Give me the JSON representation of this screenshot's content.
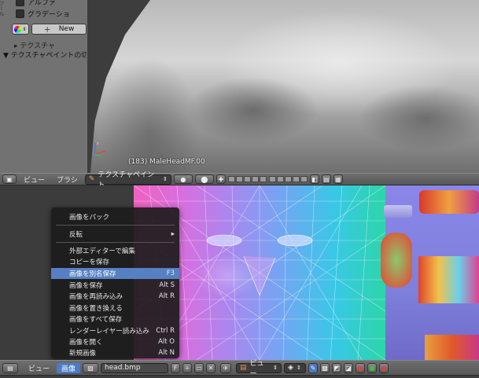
{
  "tool_panel": {
    "handle_label": "ツール",
    "alpha_label": "アルファ",
    "gradient_label": "グラデーショ",
    "new_label": "New",
    "texture_section": "テクスチャ",
    "texture_paint_section": "▼ テクスチャペイントの切"
  },
  "viewport": {
    "info": "(183) MaleHeadMF.00"
  },
  "header_top": {
    "view": "ビュー",
    "brush": "ブラシ",
    "mode": "テクスチャペイント"
  },
  "header_bottom": {
    "view": "ビュー",
    "image": "画像",
    "image_name": "head.bmp",
    "fake_user": "F",
    "view_mode": "ビュー"
  },
  "image_menu": {
    "items": [
      {
        "label": "画像をパック",
        "shortcut": ""
      },
      {
        "label": "反転",
        "shortcut": "▸"
      },
      {
        "label": "外部エディターで編集",
        "shortcut": ""
      },
      {
        "label": "コピーを保存",
        "shortcut": ""
      },
      {
        "label": "画像を別名保存",
        "shortcut": "F3"
      },
      {
        "label": "画像を保存",
        "shortcut": "Alt S"
      },
      {
        "label": "画像を再読み込み",
        "shortcut": "Alt R"
      },
      {
        "label": "画像を置き換える",
        "shortcut": ""
      },
      {
        "label": "画像をすべて保存",
        "shortcut": ""
      },
      {
        "label": "レンダーレイヤー読み込み",
        "shortcut": "Ctrl R"
      },
      {
        "label": "画像を開く",
        "shortcut": "Alt O"
      },
      {
        "label": "新規画像",
        "shortcut": "Alt N"
      }
    ],
    "highlighted_index": 4,
    "highlight_color": "#5680c2"
  },
  "colors": {
    "header": "#5f5f5f",
    "active_menu": "#4b7bc6",
    "panel": "#727272"
  }
}
